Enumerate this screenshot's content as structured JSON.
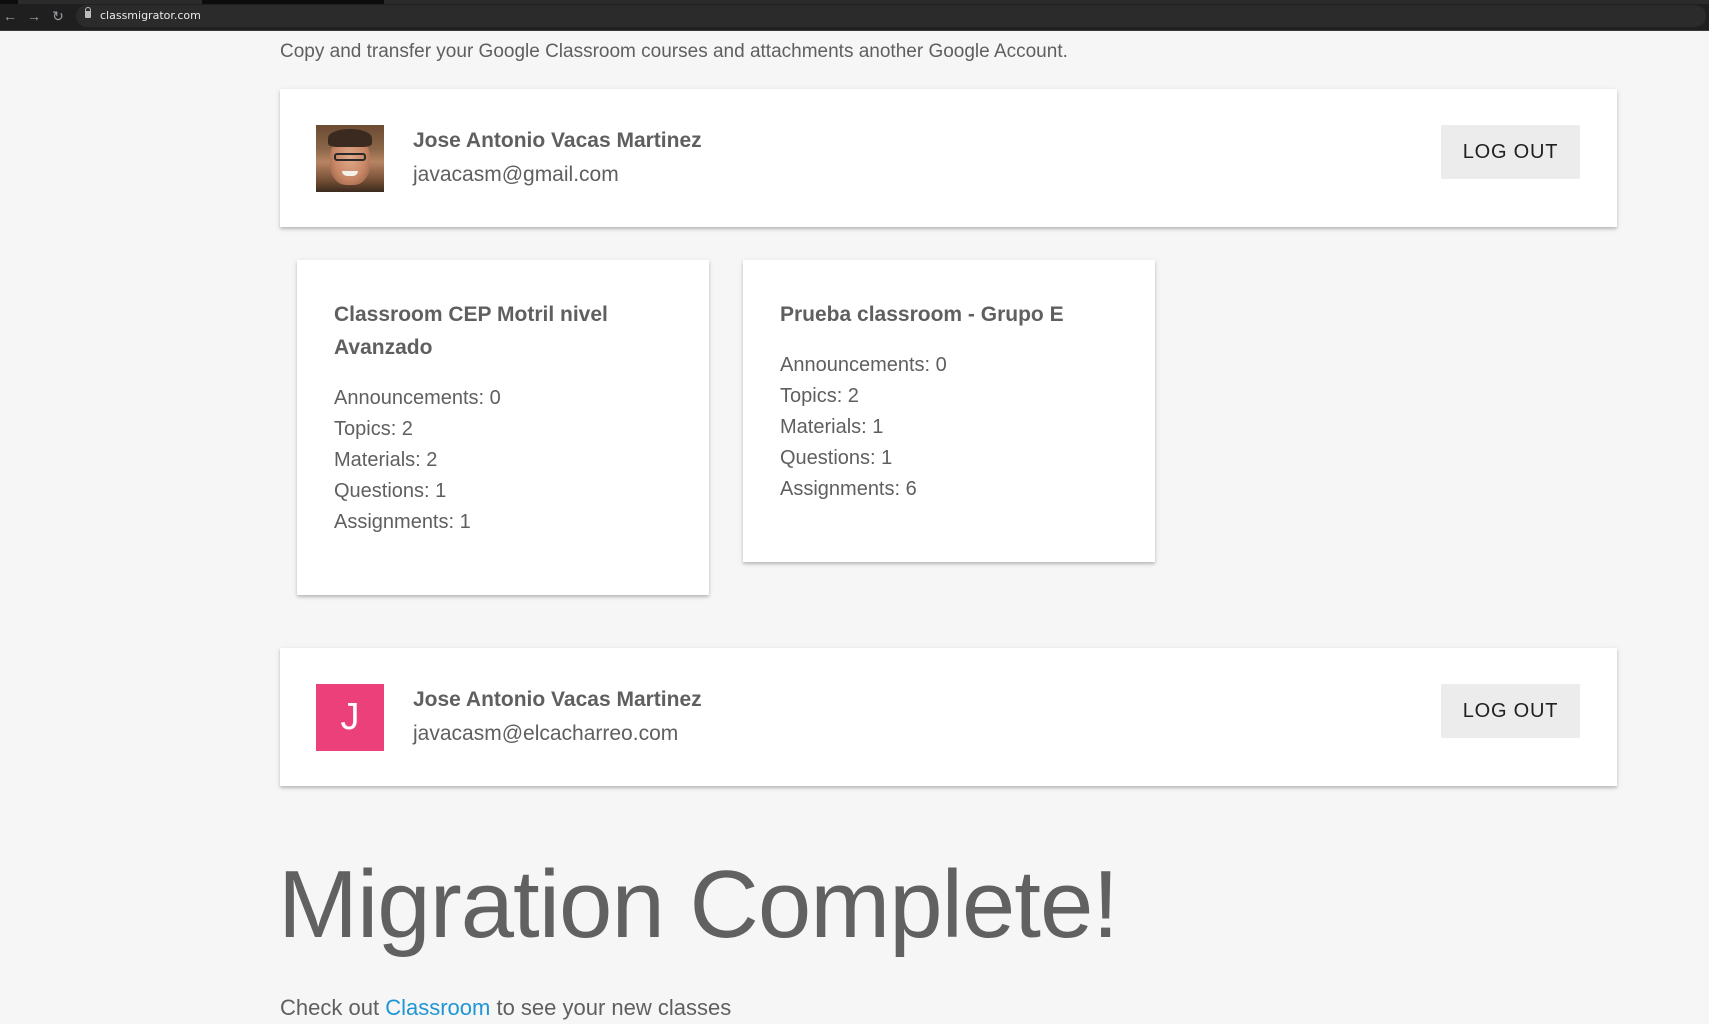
{
  "browser": {
    "url": "classmigrator.com",
    "icons": {
      "back": "arrow-left-icon",
      "forward": "arrow-right-icon",
      "reload": "reload-icon",
      "lock": "lock-icon"
    }
  },
  "intro": "Copy and transfer your Google Classroom courses and attachments another Google Account.",
  "source_account": {
    "name": "Jose Antonio Vacas Martinez",
    "email": "javacasm@gmail.com",
    "logout_label": "LOG OUT"
  },
  "courses": [
    {
      "title": "Classroom CEP Motril nivel Avanzado",
      "stats": [
        "Announcements: 0",
        "Topics: 2",
        "Materials: 2",
        "Questions: 1",
        "Assignments: 1"
      ]
    },
    {
      "title": "Prueba classroom - Grupo E",
      "stats": [
        "Announcements: 0",
        "Topics: 2",
        "Materials: 1",
        "Questions: 1",
        "Assignments: 6"
      ]
    }
  ],
  "target_account": {
    "avatar_letter": "J",
    "avatar_color": "#ec407a",
    "name": "Jose Antonio Vacas Martinez",
    "email": "javacasm@elcacharreo.com",
    "logout_label": "LOG OUT"
  },
  "migration": {
    "title": "Migration Complete!",
    "footer_prefix": "Check out",
    "footer_link": "Classroom",
    "footer_suffix": "to see your new classes",
    "link_color": "#1f95d4"
  }
}
